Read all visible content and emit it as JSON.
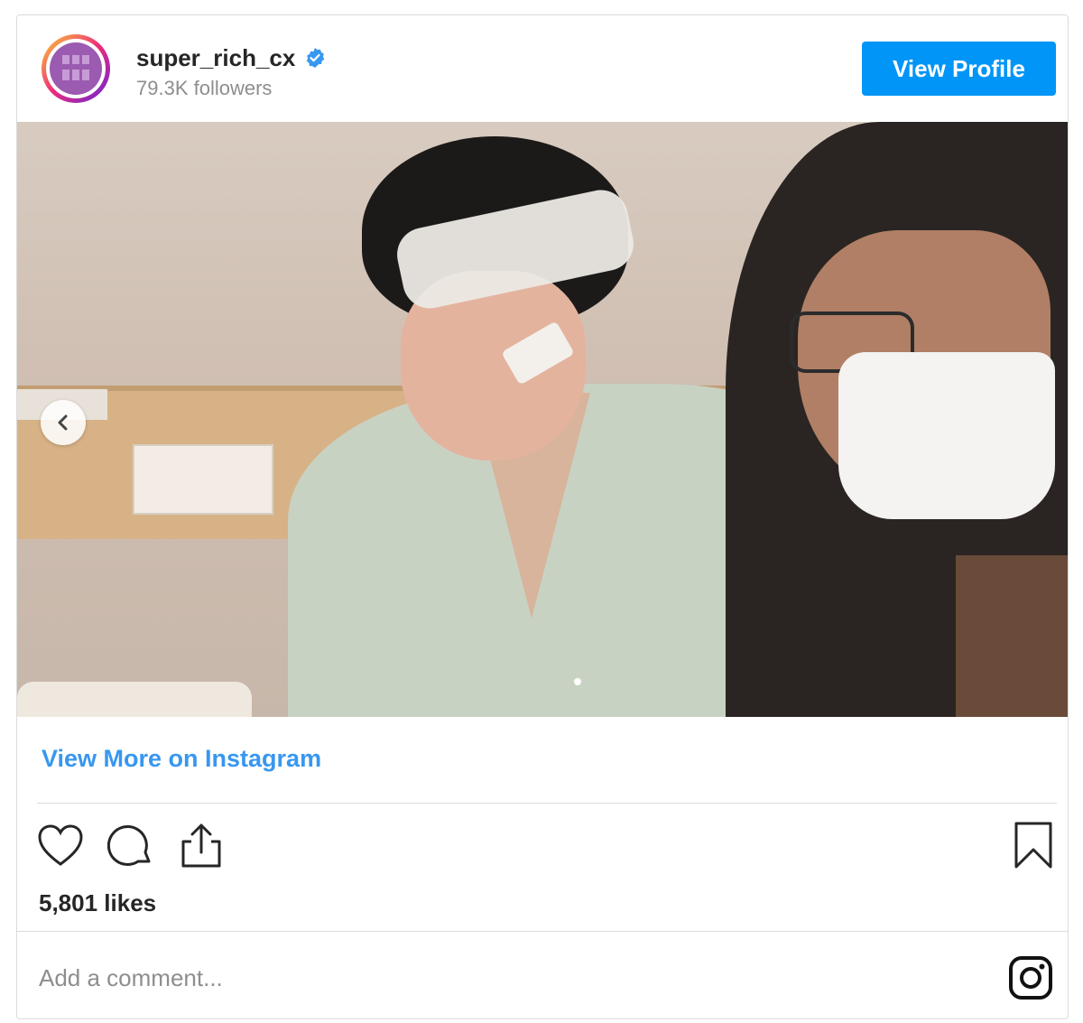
{
  "header": {
    "username": "super_rich_cx",
    "followers": "79.3K followers",
    "view_profile_label": "View Profile",
    "verified_icon": "verified-badge-icon"
  },
  "media": {
    "carousel_prev_icon": "chevron-left-icon",
    "carousel_index": 1
  },
  "footer": {
    "view_more_label": "View More on Instagram",
    "likes": "5,801 likes",
    "comment_placeholder": "Add a comment...",
    "actions": [
      "heart-icon",
      "comment-icon",
      "share-icon",
      "bookmark-icon"
    ],
    "brand_icon": "instagram-icon"
  },
  "colors": {
    "accent": "#0095f6",
    "link": "#3897f0",
    "muted": "#8e8e8e",
    "border": "#dbdbdb"
  }
}
